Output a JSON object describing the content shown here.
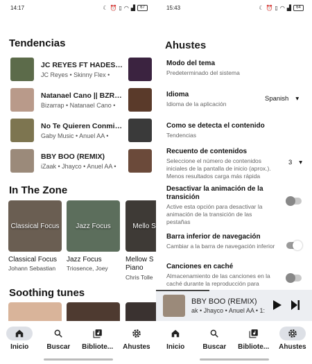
{
  "left": {
    "status": {
      "time": "14:17",
      "battery": "67"
    },
    "trending_title": "Tendencias",
    "trending": [
      {
        "title": "JC REYES FT HADES 6...",
        "subtitle": "JC Reyes • Skinny Flex •",
        "thumb": "#5c6b4a",
        "side": "#3b2340"
      },
      {
        "title": "Natanael Cano || BZRP ...",
        "subtitle": "Bizarrap • Natanael Cano •",
        "thumb": "#b99a8a",
        "side": "#5a3a2a"
      },
      {
        "title": "No Te Quieren Conmigo...",
        "subtitle": "Gaby Music • Anuel AA •",
        "thumb": "#7d7550",
        "side": "#3a3a3a"
      },
      {
        "title": "BBY BOO (REMIX)",
        "subtitle": "iZaak • Jhayco • Anuel AA •",
        "thumb": "#9b8a7a",
        "side": "#6b4a3a"
      }
    ],
    "zone_title": "In The Zone",
    "zone": [
      {
        "title": "Classical Focus",
        "subtitle": "Johann Sebastian",
        "art_text": "Classical Focus",
        "color": "#6a5e52"
      },
      {
        "title": "Jazz Focus",
        "subtitle": "Triosence, Joey",
        "art_text": "Jazz Focus",
        "color": "#5c6e5c"
      },
      {
        "title": "Mellow S Piano",
        "subtitle": "Chris Tolle",
        "art_text": "Mello Solo P",
        "color": "#3e3a36"
      }
    ],
    "soothing_title": "Soothing tunes",
    "soothing_colors": [
      "#d9b49a",
      "#4e3a30",
      "#3a3230"
    ],
    "nav": [
      {
        "label": "Inicio",
        "icon": "home-icon",
        "active": true
      },
      {
        "label": "Buscar",
        "icon": "search-icon",
        "active": false
      },
      {
        "label": "Bibliote...",
        "icon": "library-icon",
        "active": false
      },
      {
        "label": "Ahustes",
        "icon": "gear-icon",
        "active": false
      }
    ]
  },
  "right": {
    "status": {
      "time": "15:43",
      "battery": "64"
    },
    "title": "Ahustes",
    "settings": [
      {
        "title": "Modo del tema",
        "desc": "Predeterminado del sistema"
      },
      {
        "title": "Idioma",
        "desc": "Idioma de la aplicación",
        "value": "Spanish"
      },
      {
        "title": "Como se detecta el contenido",
        "desc": "Tendencias"
      },
      {
        "title": "Recuento de contenidos",
        "desc": "Seleccione el número de contenidos iniciales de la pantalla de inicio (aprox.). Menos resultados carga más rápida",
        "value": "3"
      },
      {
        "title": "Desactivar la animación de la transición",
        "desc": "Active esta opción para desactivar la animación de la transición de las pestañas",
        "toggle": false
      },
      {
        "title": "Barra inferior de navegación",
        "desc": "Cambiar a la barra de navegación inferior",
        "toggle": true
      },
      {
        "title": "Canciones en caché",
        "desc": "Almacenamiento de las canciones en la caché durante la reproducción para",
        "toggle": false
      }
    ],
    "player": {
      "title": "BBY BOO (REMIX)",
      "subtitle": "ak • Jhayco • Anuel AA • 1:",
      "progress": 0.34
    },
    "nav": [
      {
        "label": "Inicio",
        "icon": "home-icon",
        "active": false
      },
      {
        "label": "Buscar",
        "icon": "search-icon",
        "active": false
      },
      {
        "label": "Bibliote...",
        "icon": "library-icon",
        "active": false
      },
      {
        "label": "Ahustes",
        "icon": "gear-icon",
        "active": true
      }
    ]
  }
}
